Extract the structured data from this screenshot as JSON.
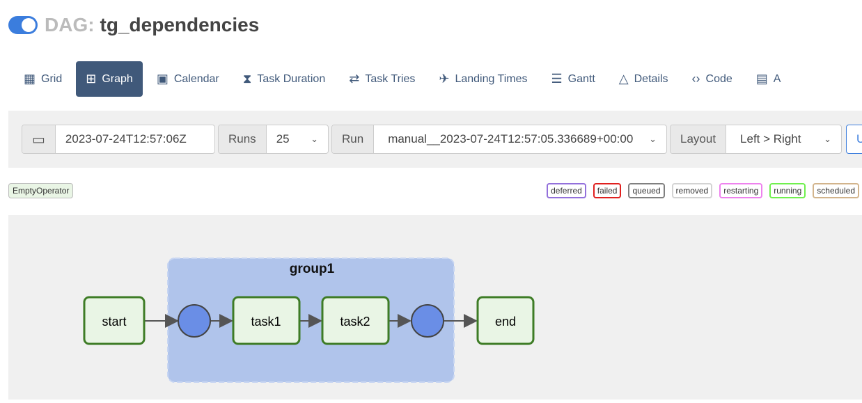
{
  "header": {
    "prefix": "DAG:",
    "dag_id": "tg_dependencies",
    "paused": false
  },
  "nav": [
    {
      "label": "Grid",
      "icon": "grid-icon"
    },
    {
      "label": "Graph",
      "icon": "graph-icon"
    },
    {
      "label": "Calendar",
      "icon": "calendar-icon"
    },
    {
      "label": "Task Duration",
      "icon": "hourglass-icon"
    },
    {
      "label": "Task Tries",
      "icon": "repeat-icon"
    },
    {
      "label": "Landing Times",
      "icon": "plane-landing-icon"
    },
    {
      "label": "Gantt",
      "icon": "gantt-icon"
    },
    {
      "label": "Details",
      "icon": "details-icon"
    },
    {
      "label": "Code",
      "icon": "code-icon"
    },
    {
      "label": "A",
      "icon": "audit-log-icon"
    }
  ],
  "controls": {
    "date": "2023-07-24T12:57:06Z",
    "runs_label": "Runs",
    "runs": "25",
    "run_label": "Run",
    "run": "manual__2023-07-24T12:57:05.336689+00:00",
    "layout_label": "Layout",
    "layout": "Left > Right",
    "update": "U"
  },
  "operator": "EmptyOperator",
  "states": [
    {
      "label": "deferred",
      "color": "#9370db"
    },
    {
      "label": "failed",
      "color": "#e0201f"
    },
    {
      "label": "queued",
      "color": "#808080"
    },
    {
      "label": "removed",
      "color": "#d3d3d3"
    },
    {
      "label": "restarting",
      "color": "#ee82ee"
    },
    {
      "label": "running",
      "color": "#70f04e"
    },
    {
      "label": "scheduled",
      "color": "#d2b48c"
    }
  ],
  "graph": {
    "group": "group1",
    "nodes": [
      "start",
      "task1",
      "task2",
      "end"
    ]
  }
}
